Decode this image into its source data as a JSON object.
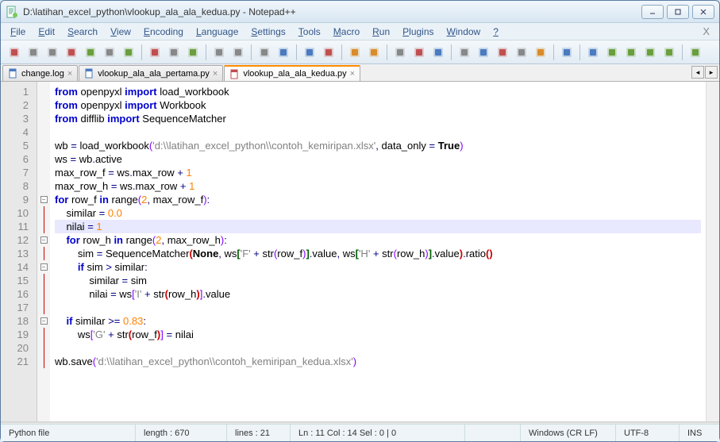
{
  "window": {
    "title": "D:\\latihan_excel_python\\vlookup_ala_ala_kedua.py - Notepad++"
  },
  "menu": [
    "File",
    "Edit",
    "Search",
    "View",
    "Encoding",
    "Language",
    "Settings",
    "Tools",
    "Macro",
    "Run",
    "Plugins",
    "Window",
    "?"
  ],
  "tabs": [
    {
      "label": "change.log",
      "active": false,
      "saved": true
    },
    {
      "label": "vlookup_ala_ala_pertama.py",
      "active": false,
      "saved": true
    },
    {
      "label": "vlookup_ala_ala_kedua.py",
      "active": true,
      "saved": false
    }
  ],
  "code": {
    "current_line": 11,
    "lines": [
      {
        "n": 1,
        "tokens": [
          [
            "kw",
            "from"
          ],
          [
            "nm",
            " openpyxl "
          ],
          [
            "kw",
            "import"
          ],
          [
            "nm",
            " load_workbook"
          ]
        ]
      },
      {
        "n": 2,
        "tokens": [
          [
            "kw",
            "from"
          ],
          [
            "nm",
            " openpyxl "
          ],
          [
            "kw",
            "import"
          ],
          [
            "nm",
            " Workbook"
          ]
        ]
      },
      {
        "n": 3,
        "tokens": [
          [
            "kw",
            "from"
          ],
          [
            "nm",
            " difflib "
          ],
          [
            "kw",
            "import"
          ],
          [
            "nm",
            " SequenceMatcher"
          ]
        ]
      },
      {
        "n": 4,
        "tokens": []
      },
      {
        "n": 5,
        "tokens": [
          [
            "nm",
            "wb "
          ],
          [
            "op",
            "="
          ],
          [
            "nm",
            " load_workbook"
          ],
          [
            "paren",
            "("
          ],
          [
            "str",
            "'d:\\\\latihan_excel_python\\\\contoh_kemiripan.xlsx'"
          ],
          [
            "op",
            ","
          ],
          [
            "nm",
            " data_only "
          ],
          [
            "op",
            "="
          ],
          [
            "nm",
            " "
          ],
          [
            "bnone",
            "True"
          ],
          [
            "paren",
            ")"
          ]
        ]
      },
      {
        "n": 6,
        "tokens": [
          [
            "nm",
            "ws "
          ],
          [
            "op",
            "="
          ],
          [
            "nm",
            " wb"
          ],
          [
            "op",
            "."
          ],
          [
            "nm",
            "active"
          ]
        ]
      },
      {
        "n": 7,
        "tokens": [
          [
            "nm",
            "max_row_f "
          ],
          [
            "op",
            "="
          ],
          [
            "nm",
            " ws"
          ],
          [
            "op",
            "."
          ],
          [
            "nm",
            "max_row "
          ],
          [
            "op",
            "+"
          ],
          [
            "nm",
            " "
          ],
          [
            "num",
            "1"
          ]
        ]
      },
      {
        "n": 8,
        "tokens": [
          [
            "nm",
            "max_row_h "
          ],
          [
            "op",
            "="
          ],
          [
            "nm",
            " ws"
          ],
          [
            "op",
            "."
          ],
          [
            "nm",
            "max_row "
          ],
          [
            "op",
            "+"
          ],
          [
            "nm",
            " "
          ],
          [
            "num",
            "1"
          ]
        ]
      },
      {
        "n": 9,
        "fold": "start",
        "tokens": [
          [
            "kw",
            "for"
          ],
          [
            "nm",
            " row_f "
          ],
          [
            "kw",
            "in"
          ],
          [
            "nm",
            " range"
          ],
          [
            "paren",
            "("
          ],
          [
            "num",
            "2"
          ],
          [
            "op",
            ","
          ],
          [
            "nm",
            " max_row_f"
          ],
          [
            "paren",
            ")"
          ],
          [
            "op",
            ":"
          ]
        ]
      },
      {
        "n": 10,
        "tokens": [
          [
            "nm",
            "    similar "
          ],
          [
            "op",
            "="
          ],
          [
            "nm",
            " "
          ],
          [
            "num",
            "0.0"
          ]
        ]
      },
      {
        "n": 11,
        "tokens": [
          [
            "nm",
            "    nilai "
          ],
          [
            "op",
            "="
          ],
          [
            "nm",
            " "
          ],
          [
            "num",
            "1"
          ]
        ]
      },
      {
        "n": 12,
        "fold": "start",
        "tokens": [
          [
            "nm",
            "    "
          ],
          [
            "kw",
            "for"
          ],
          [
            "nm",
            " row_h "
          ],
          [
            "kw",
            "in"
          ],
          [
            "nm",
            " range"
          ],
          [
            "paren",
            "("
          ],
          [
            "num",
            "2"
          ],
          [
            "op",
            ","
          ],
          [
            "nm",
            " max_row_h"
          ],
          [
            "paren",
            ")"
          ],
          [
            "op",
            ":"
          ]
        ]
      },
      {
        "n": 13,
        "tokens": [
          [
            "nm",
            "        sim "
          ],
          [
            "op",
            "="
          ],
          [
            "nm",
            " SequenceMatcher"
          ],
          [
            "br1",
            "("
          ],
          [
            "bnone",
            "None"
          ],
          [
            "op",
            ","
          ],
          [
            "nm",
            " ws"
          ],
          [
            "br2",
            "["
          ],
          [
            "str",
            "'F'"
          ],
          [
            "nm",
            " "
          ],
          [
            "op",
            "+"
          ],
          [
            "nm",
            " str"
          ],
          [
            "paren",
            "("
          ],
          [
            "nm",
            "row_f"
          ],
          [
            "paren",
            ")"
          ],
          [
            "br2",
            "]"
          ],
          [
            "op",
            "."
          ],
          [
            "nm",
            "value"
          ],
          [
            "op",
            ","
          ],
          [
            "nm",
            " ws"
          ],
          [
            "br2",
            "["
          ],
          [
            "str",
            "'H'"
          ],
          [
            "nm",
            " "
          ],
          [
            "op",
            "+"
          ],
          [
            "nm",
            " str"
          ],
          [
            "paren",
            "("
          ],
          [
            "nm",
            "row_h"
          ],
          [
            "paren",
            ")"
          ],
          [
            "br2",
            "]"
          ],
          [
            "op",
            "."
          ],
          [
            "nm",
            "value"
          ],
          [
            "br1",
            ")"
          ],
          [
            "op",
            "."
          ],
          [
            "nm",
            "ratio"
          ],
          [
            "br1",
            "()"
          ]
        ]
      },
      {
        "n": 14,
        "fold": "start",
        "tokens": [
          [
            "nm",
            "        "
          ],
          [
            "kw",
            "if"
          ],
          [
            "nm",
            " sim "
          ],
          [
            "op",
            ">"
          ],
          [
            "nm",
            " similar"
          ],
          [
            "op",
            ":"
          ]
        ]
      },
      {
        "n": 15,
        "tokens": [
          [
            "nm",
            "            similar "
          ],
          [
            "op",
            "="
          ],
          [
            "nm",
            " sim"
          ]
        ]
      },
      {
        "n": 16,
        "tokens": [
          [
            "nm",
            "            nilai "
          ],
          [
            "op",
            "="
          ],
          [
            "nm",
            " ws"
          ],
          [
            "paren",
            "["
          ],
          [
            "str",
            "'I'"
          ],
          [
            "nm",
            " "
          ],
          [
            "op",
            "+"
          ],
          [
            "nm",
            " str"
          ],
          [
            "br1",
            "("
          ],
          [
            "nm",
            "row_h"
          ],
          [
            "br1",
            ")"
          ],
          [
            "paren",
            "]"
          ],
          [
            "op",
            "."
          ],
          [
            "nm",
            "value"
          ]
        ]
      },
      {
        "n": 17,
        "tokens": []
      },
      {
        "n": 18,
        "fold": "start",
        "tokens": [
          [
            "nm",
            "    "
          ],
          [
            "kw",
            "if"
          ],
          [
            "nm",
            " similar "
          ],
          [
            "op",
            ">="
          ],
          [
            "nm",
            " "
          ],
          [
            "num",
            "0.83"
          ],
          [
            "op",
            ":"
          ]
        ]
      },
      {
        "n": 19,
        "tokens": [
          [
            "nm",
            "        ws"
          ],
          [
            "paren",
            "["
          ],
          [
            "str",
            "'G'"
          ],
          [
            "nm",
            " "
          ],
          [
            "op",
            "+"
          ],
          [
            "nm",
            " str"
          ],
          [
            "br1",
            "("
          ],
          [
            "nm",
            "row_f"
          ],
          [
            "br1",
            ")"
          ],
          [
            "paren",
            "]"
          ],
          [
            "nm",
            " "
          ],
          [
            "op",
            "="
          ],
          [
            "nm",
            " nilai"
          ]
        ]
      },
      {
        "n": 20,
        "tokens": []
      },
      {
        "n": 21,
        "tokens": [
          [
            "nm",
            "wb"
          ],
          [
            "op",
            "."
          ],
          [
            "nm",
            "save"
          ],
          [
            "paren",
            "("
          ],
          [
            "str",
            "'d:\\\\latihan_excel_python\\\\contoh_kemiripan_kedua.xlsx'"
          ],
          [
            "paren",
            ")"
          ]
        ]
      }
    ]
  },
  "status": {
    "filetype": "Python file",
    "length": "length : 670",
    "lines": "lines : 21",
    "pos": "Ln : 11    Col : 14    Sel : 0 | 0",
    "eol": "Windows (CR LF)",
    "enc": "UTF-8",
    "ins": "INS"
  },
  "toolbar_icons": [
    "new-file-icon",
    "open-file-icon",
    "save-icon",
    "save-all-icon",
    "close-icon",
    "close-all-icon",
    "print-icon",
    "sep",
    "cut-icon",
    "copy-icon",
    "paste-icon",
    "sep",
    "undo-icon",
    "redo-icon",
    "sep",
    "find-icon",
    "replace-icon",
    "sep",
    "zoom-in-icon",
    "zoom-out-icon",
    "sep",
    "sync-v-icon",
    "sync-h-icon",
    "sep",
    "wrap-icon",
    "show-all-icon",
    "indent-guide-icon",
    "sep",
    "lang-icon",
    "doc-map-icon",
    "doc-list-icon",
    "func-list-icon",
    "folder-icon",
    "sep",
    "monitor-icon",
    "sep",
    "record-macro-icon",
    "stop-macro-icon",
    "play-macro-icon",
    "play-multi-icon",
    "save-macro-icon",
    "sep",
    "spell-icon"
  ]
}
